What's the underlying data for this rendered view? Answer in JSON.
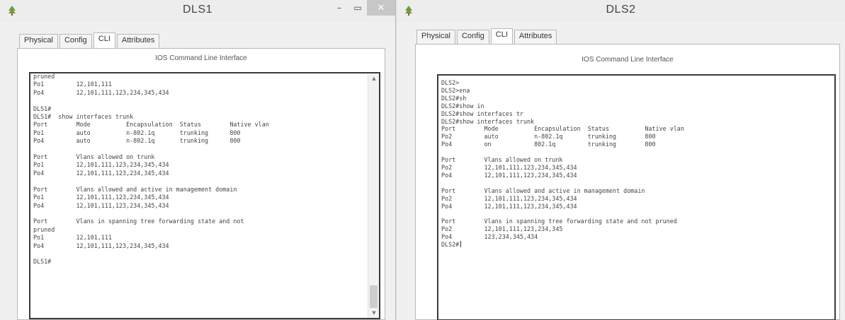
{
  "left": {
    "title": "DLS1",
    "window_buttons": {
      "minimize": "–",
      "maximize": "▭",
      "close": "✕"
    },
    "tabs": [
      "Physical",
      "Config",
      "CLI",
      "Attributes"
    ],
    "active_tab": "CLI",
    "cli_title": "IOS Command Line Interface",
    "terminal_text": "pruned\nPo1         12,101,111\nPo4         12,101,111,123,234,345,434\n\nDLS1#\nDLS1#  show interfaces trunk\nPort        Mode          Encapsulation  Status        Native vlan\nPo1         auto          n-802.1q       trunking      800\nPo4         auto          n-802.1q       trunking      800\n\nPort        Vlans allowed on trunk\nPo1         12,101,111,123,234,345,434\nPo4         12,101,111,123,234,345,434\n\nPort        Vlans allowed and active in management domain\nPo1         12,101,111,123,234,345,434\nPo4         12,101,111,123,234,345,434\n\nPort        Vlans in spanning tree forwarding state and not\npruned\nPo1         12,101,111\nPo4         12,101,111,123,234,345,434\n\nDLS1#"
  },
  "right": {
    "title": "DLS2",
    "tabs": [
      "Physical",
      "Config",
      "CLI",
      "Attributes"
    ],
    "active_tab": "CLI",
    "cli_title": "IOS Command Line Interface",
    "terminal_text": "DLS2>\nDLS2>ena\nDLS2#sh\nDLS2#show in\nDLS2#show interfaces tr\nDLS2#show interfaces trunk\nPort        Mode          Encapsulation  Status          Native vlan\nPo2         auto          n-802.1q       trunking        800\nPo4         on            802.1q         trunking        800\n\nPort        Vlans allowed on trunk\nPo2         12,101,111,123,234,345,434\nPo4         12,101,111,123,234,345,434\n\nPort        Vlans allowed and active in management domain\nPo2         12,101,111,123,234,345,434\nPo4         12,101,111,123,234,345,434\n\nPort        Vlans in spanning tree forwarding state and not pruned\nPo2         12,101,111,123,234,345\nPo4         123,234,345,434\n",
    "prompt": "DLS2#"
  },
  "icons": {
    "app": "tree-icon",
    "scroll_up": "arrow-up-icon",
    "scroll_down": "arrow-down-icon"
  }
}
